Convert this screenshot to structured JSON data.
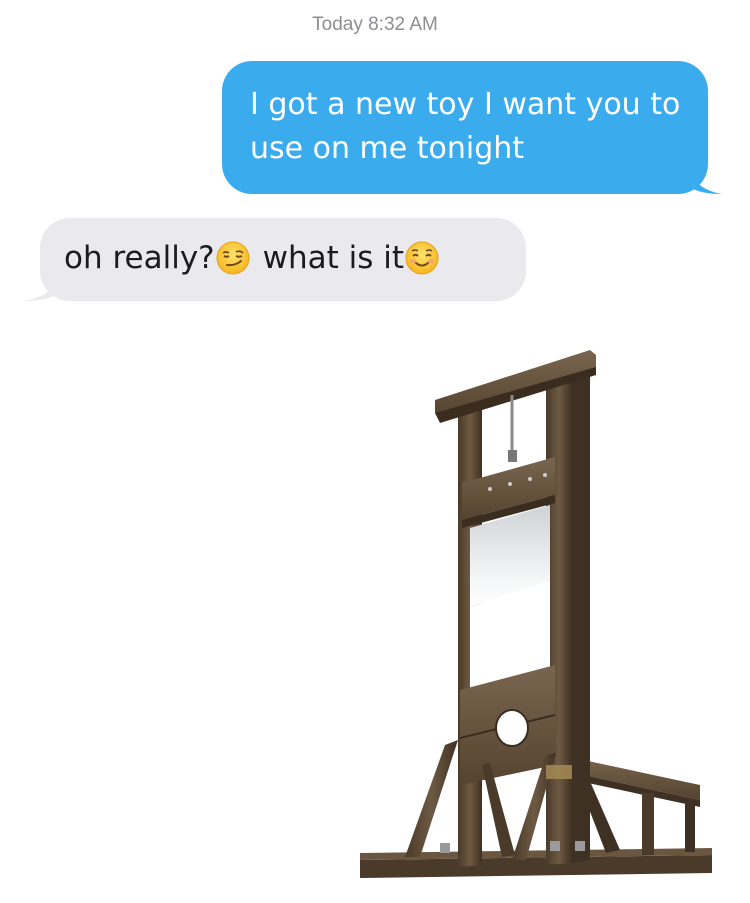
{
  "conversation": {
    "timestamp": "Today 8:32 AM",
    "messages": [
      {
        "direction": "sent",
        "text": "I got a new toy I want you to use on me tonight"
      },
      {
        "direction": "received",
        "parts": [
          "oh really?",
          "what is it"
        ],
        "emojis": [
          "smirking-face",
          "smiling-face-with-closed-eyes"
        ]
      }
    ],
    "image_attachment": {
      "subject": "guillotine-icon"
    }
  },
  "colors": {
    "sent_bubble": "#3aacee",
    "received_bubble": "#e9e9ee",
    "timestamp": "#8e8e93"
  }
}
